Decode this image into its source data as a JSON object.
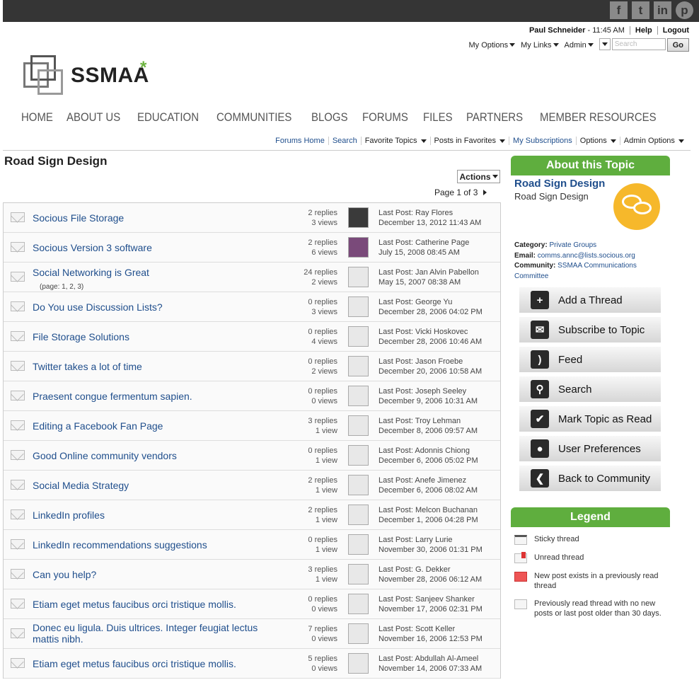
{
  "user": {
    "name": "Paul Schneider",
    "time": "- 11:45 AM",
    "help": "Help",
    "logout": "Logout"
  },
  "options": {
    "my_options": "My Options",
    "my_links": "My Links",
    "admin": "Admin",
    "search_placeholder": "Search",
    "go": "Go"
  },
  "social": [
    "f",
    "t",
    "in",
    "p"
  ],
  "logo": {
    "text": "SSMAA",
    "star": "*"
  },
  "nav": [
    "HOME",
    "ABOUT US",
    "EDUCATION",
    "COMMUNITIES",
    "BLOGS",
    "FORUMS",
    "FILES",
    "PARTNERS",
    "MEMBER RESOURCES"
  ],
  "subnav": {
    "forums_home": "Forums Home",
    "search": "Search",
    "favorite_topics": "Favorite Topics",
    "posts_in_favorites": "Posts in Favorites",
    "my_subscriptions": "My Subscriptions",
    "options": "Options",
    "admin_options": "Admin Options"
  },
  "page": {
    "title": "Road Sign Design",
    "actions": "Actions",
    "pagination": "Page 1 of 3"
  },
  "threads": [
    {
      "title": "Socious File Storage",
      "replies": "2 replies",
      "views": "3 views",
      "last": "Last Post: Ray Flores",
      "date": "December 13, 2012 11:43 AM"
    },
    {
      "title": "Socious Version 3 software",
      "replies": "2 replies",
      "views": "6 views",
      "last": "Last Post: Catherine Page",
      "date": "July 15, 2008 08:45 AM"
    },
    {
      "title": "Social Networking is Great",
      "pages": "(page: 1, 2, 3)",
      "replies": "24 replies",
      "views": "2 views",
      "last": "Last Post: Jan Alvin Pabellon",
      "date": "May 15, 2007 08:38 AM"
    },
    {
      "title": "Do You use Discussion Lists?",
      "replies": "0 replies",
      "views": "3 views",
      "last": "Last Post: George Yu",
      "date": "December 28, 2006 04:02 PM"
    },
    {
      "title": "File Storage Solutions",
      "replies": "0 replies",
      "views": "4 views",
      "last": "Last Post: Vicki Hoskovec",
      "date": "December 28, 2006 10:46 AM"
    },
    {
      "title": "Twitter takes a lot of time",
      "replies": "0 replies",
      "views": "2 views",
      "last": "Last Post: Jason Froebe",
      "date": "December 20, 2006 10:58 AM"
    },
    {
      "title": "Praesent congue fermentum sapien.",
      "replies": "0 replies",
      "views": "0 views",
      "last": "Last Post: Joseph Seeley",
      "date": "December 9, 2006 10:31 AM"
    },
    {
      "title": "Editing a Facebook Fan Page",
      "replies": "3 replies",
      "views": "1 view",
      "last": "Last Post: Troy Lehman",
      "date": "December 8, 2006 09:57 AM"
    },
    {
      "title": "Good Online community vendors",
      "replies": "0 replies",
      "views": "1 view",
      "last": "Last Post: Adonnis Chiong",
      "date": "December 6, 2006 05:02 PM"
    },
    {
      "title": "Social Media Strategy",
      "replies": "2 replies",
      "views": "1 view",
      "last": "Last Post: Anefe Jimenez",
      "date": "December 6, 2006 08:02 AM"
    },
    {
      "title": "LinkedIn profiles",
      "replies": "2 replies",
      "views": "1 view",
      "last": "Last Post: Melcon Buchanan",
      "date": "December 1, 2006 04:28 PM"
    },
    {
      "title": "LinkedIn recommendations suggestions",
      "replies": "0 replies",
      "views": "1 view",
      "last": "Last Post: Larry Lurie",
      "date": "November 30, 2006 01:31 PM"
    },
    {
      "title": "Can you help?",
      "replies": "3 replies",
      "views": "1 view",
      "last": "Last Post: G. Dekker",
      "date": "November 28, 2006 06:12 AM"
    },
    {
      "title": "Etiam eget metus faucibus orci tristique mollis.",
      "replies": "0 replies",
      "views": "0 views",
      "last": "Last Post: Sanjeev Shanker",
      "date": "November 17, 2006 02:31 PM"
    },
    {
      "title": "Donec eu ligula. Duis ultrices. Integer feugiat lectus mattis nibh.",
      "replies": "7 replies",
      "views": "0 views",
      "last": "Last Post: Scott Keller",
      "date": "November 16, 2006 12:53 PM"
    },
    {
      "title": "Etiam eget metus faucibus orci tristique mollis.",
      "replies": "5 replies",
      "views": "0 views",
      "last": "Last Post: Abdullah Al-Ameel",
      "date": "November 14, 2006 07:33 AM"
    }
  ],
  "about": {
    "header": "About this Topic",
    "title": "Road Sign Design",
    "subtitle": "Road Sign Design",
    "category_label": "Category:",
    "category": "Private Groups",
    "email_label": "Email:",
    "email": "comms.annc@lists.socious.org",
    "community_label": "Community:",
    "community": "SSMAA Communications Committee"
  },
  "action_buttons": [
    {
      "label": "Add a Thread",
      "icon": "add-thread-icon",
      "glyph": "+"
    },
    {
      "label": "Subscribe to Topic",
      "icon": "subscribe-icon",
      "glyph": "✉"
    },
    {
      "label": "Feed",
      "icon": "rss-icon",
      "glyph": ")"
    },
    {
      "label": "Search",
      "icon": "search-icon",
      "glyph": "⚲"
    },
    {
      "label": "Mark Topic as Read",
      "icon": "checkmark-icon",
      "glyph": "✔"
    },
    {
      "label": "User Preferences",
      "icon": "user-icon",
      "glyph": "●"
    },
    {
      "label": "Back to Community",
      "icon": "back-arrow-icon",
      "glyph": "❮"
    }
  ],
  "legend": {
    "header": "Legend",
    "items": [
      {
        "text": "Sticky thread",
        "icon": "sticky-thread-icon"
      },
      {
        "text": "Unread thread",
        "icon": "unread-thread-icon"
      },
      {
        "text": "New post exists in a previously read thread",
        "icon": "new-post-icon"
      },
      {
        "text": "Previously read thread with no new posts or last post older than 30 days.",
        "icon": "read-thread-icon"
      }
    ]
  }
}
